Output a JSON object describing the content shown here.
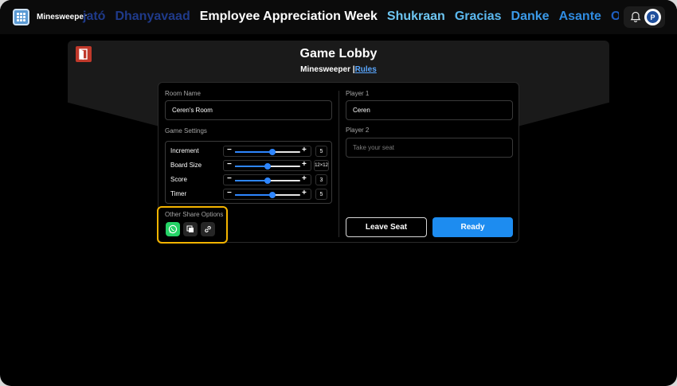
{
  "app": {
    "name": "Minesweeper"
  },
  "banner": {
    "words": [
      {
        "text": "jató",
        "color": "#1f3a8a"
      },
      {
        "text": "Dhanyavaad",
        "color": "#1f3a8a"
      },
      {
        "text": "Employee Appreciation Week",
        "color": "#ffffff"
      },
      {
        "text": "Shukraan",
        "color": "#6ec6f2"
      },
      {
        "text": "Gracias",
        "color": "#5bb8ef"
      },
      {
        "text": "Danke",
        "color": "#3b9ae8"
      },
      {
        "text": "Asante",
        "color": "#2f8be0"
      },
      {
        "text": "Ot",
        "color": "#1f5fc2"
      }
    ]
  },
  "header": {
    "avatar_letter": "P"
  },
  "lobby": {
    "title": "Game Lobby",
    "game": "Minesweeper",
    "separator": "|",
    "rules_link": "Rules"
  },
  "room": {
    "name_label": "Room Name",
    "name_value": "Ceren's Room",
    "settings_label": "Game Settings",
    "settings": [
      {
        "name": "Increment",
        "value": "5",
        "level": 0.57
      },
      {
        "name": "Board Size",
        "value": "12×12",
        "level": 0.5
      },
      {
        "name": "Score",
        "value": "3",
        "level": 0.5
      },
      {
        "name": "Timer",
        "value": "5",
        "level": 0.57
      }
    ],
    "share_label": "Other Share Options"
  },
  "players": {
    "p1_label": "Player 1",
    "p1_value": "Ceren",
    "p2_label": "Player 2",
    "p2_placeholder": "Take your seat"
  },
  "actions": {
    "leave": "Leave Seat",
    "ready": "Ready"
  }
}
